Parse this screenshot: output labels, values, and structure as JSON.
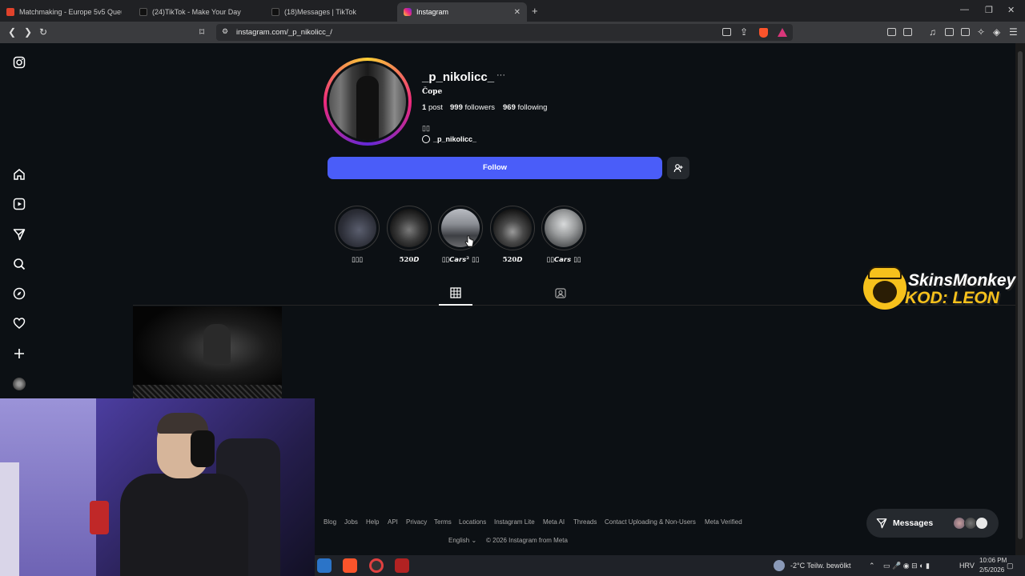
{
  "browser": {
    "tabs": [
      {
        "title": "Matchmaking - Europe 5v5 Queue - F",
        "favicon_color": "#e0422b"
      },
      {
        "title": "(24)TikTok - Make Your Day",
        "favicon_color": "#111111"
      },
      {
        "title": "(18)Messages | TikTok",
        "favicon_color": "#111111"
      },
      {
        "title": "Instagram",
        "favicon_color": "#d62976"
      }
    ],
    "active_tab": 3,
    "url": "instagram.com/_p_nikolicc_/",
    "window_controls": [
      "minimize-icon",
      "restore-icon",
      "close-icon"
    ]
  },
  "instagram": {
    "sidebar_icons": [
      "instagram-logo-icon",
      "home-icon",
      "reels-icon",
      "messages-icon",
      "search-icon",
      "explore-icon",
      "notifications-icon",
      "create-icon",
      "profile-avatar"
    ],
    "profile": {
      "username": "_p_nikolicc_",
      "more": "···",
      "display_name": "Čope",
      "posts_count": "1",
      "posts_label": "post",
      "followers_count": "999",
      "followers_label": "followers",
      "following_count": "969",
      "following_label": "following",
      "bio": "▯▯",
      "threads_handle": "_p_nikolicc_"
    },
    "follow_label": "Follow",
    "highlights": [
      {
        "label": "▯▯▯",
        "color": "#3a3d48"
      },
      {
        "label": "520𝘿",
        "color": "#2e2e31"
      },
      {
        "label": "▯▯𝘾𝙖𝙧𝙨² ▯▯",
        "color": "#6b6d72"
      },
      {
        "label": "520𝘿",
        "color": "#2a2a2c"
      },
      {
        "label": "▯▯𝘾𝙖𝙧𝙨 ▯▯",
        "color": "#7f8283"
      }
    ],
    "content_tabs": [
      "posts-grid-icon",
      "tagged-icon"
    ],
    "footer_links": [
      "Blog",
      "Jobs",
      "Help",
      "API",
      "Privacy",
      "Terms",
      "Locations",
      "Instagram Lite",
      "Meta AI",
      "Threads",
      "Contact Uploading & Non-Users",
      "Meta Verified"
    ],
    "language": "English",
    "copyright": "© 2026 Instagram from Meta",
    "messages_label": "Messages"
  },
  "overlay": {
    "brand": "SkinsMonkey",
    "code": "KOD: LEON"
  },
  "taskbar": {
    "weather": "-2°C  Teilw. bewölkt",
    "language": "HRV",
    "time": "10:06 PM",
    "date": "2/5/2026"
  }
}
